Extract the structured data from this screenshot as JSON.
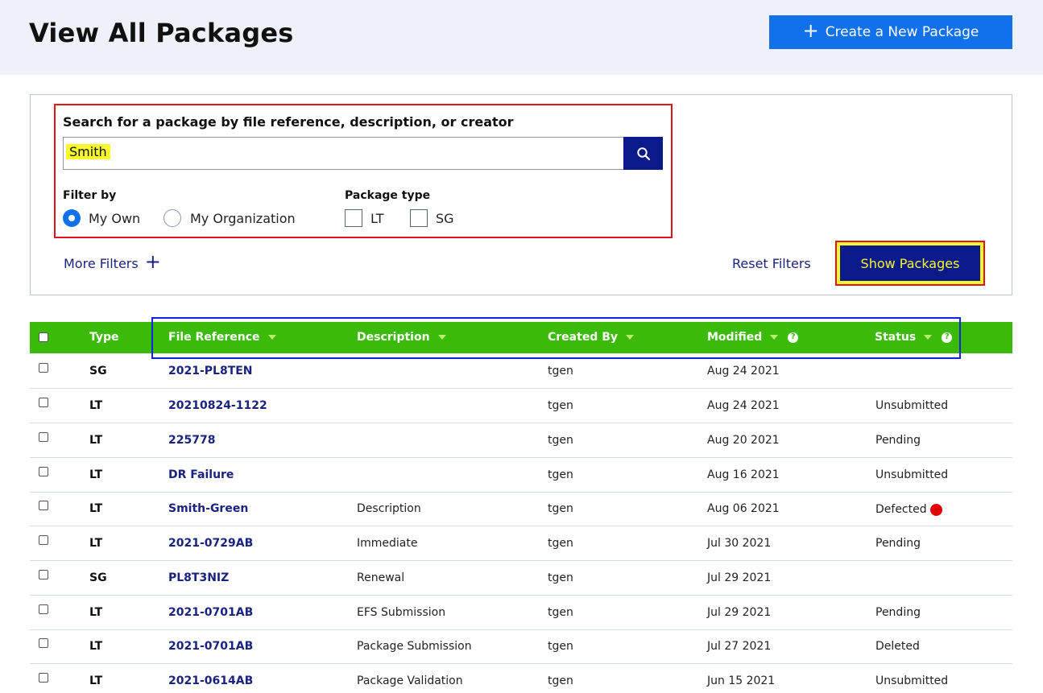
{
  "page": {
    "title": "View All Packages",
    "create_button": "Create a New Package"
  },
  "search": {
    "label": "Search for a package by file reference, description, or creator",
    "value": "Smith"
  },
  "filters": {
    "filter_by_label": "Filter by",
    "my_own": "My Own",
    "my_organization": "My Organization",
    "selected": "My Own",
    "package_type_label": "Package type",
    "type_lt": "LT",
    "type_sg": "SG",
    "more_filters": "More Filters",
    "reset_filters": "Reset Filters",
    "show_packages": "Show Packages"
  },
  "table": {
    "columns": {
      "type": "Type",
      "file_reference": "File Reference",
      "description": "Description",
      "created_by": "Created By",
      "modified": "Modified",
      "status": "Status"
    },
    "rows": [
      {
        "type": "SG",
        "ref": "2021-PL8TEN",
        "desc": "",
        "by": "tgen",
        "modified": "Aug 24 2021",
        "status": ""
      },
      {
        "type": "LT",
        "ref": "20210824-1122",
        "desc": "",
        "by": "tgen",
        "modified": "Aug 24 2021",
        "status": "Unsubmitted"
      },
      {
        "type": "LT",
        "ref": "225778",
        "desc": "",
        "by": "tgen",
        "modified": "Aug 20 2021",
        "status": "Pending"
      },
      {
        "type": "LT",
        "ref": "DR Failure",
        "desc": "",
        "by": "tgen",
        "modified": "Aug 16 2021",
        "status": "Unsubmitted"
      },
      {
        "type": "LT",
        "ref": "Smith-Green",
        "desc": "Description",
        "by": "tgen",
        "modified": "Aug 06 2021",
        "status": "Defected",
        "alert": true
      },
      {
        "type": "LT",
        "ref": "2021-0729AB",
        "desc": "Immediate",
        "by": "tgen",
        "modified": "Jul 30 2021",
        "status": "Pending"
      },
      {
        "type": "SG",
        "ref": "PL8T3NIZ",
        "desc": "Renewal",
        "by": "tgen",
        "modified": "Jul 29 2021",
        "status": ""
      },
      {
        "type": "LT",
        "ref": "2021-0701AB",
        "desc": "EFS Submission",
        "by": "tgen",
        "modified": "Jul 29 2021",
        "status": "Pending"
      },
      {
        "type": "LT",
        "ref": "2021-0701AB",
        "desc": "Package Submission",
        "by": "tgen",
        "modified": "Jul 27 2021",
        "status": "Deleted"
      },
      {
        "type": "LT",
        "ref": "2021-0614AB",
        "desc": "Package Validation",
        "by": "tgen",
        "modified": "Jun 15 2021",
        "status": "Unsubmitted"
      }
    ]
  },
  "colors": {
    "header_bg": "#eef2f8",
    "primary_blue": "#1170ec",
    "navy": "#0a1a8a",
    "table_header_green": "#3cba0a",
    "highlight_yellow": "#f8f82a",
    "annotation_red": "#e0141b",
    "annotation_blue": "#1024e0",
    "alert_red": "#e00000"
  },
  "icons": [
    "plus-icon",
    "search-icon",
    "sort-arrow-icon",
    "help-icon",
    "alert-dot-icon"
  ]
}
